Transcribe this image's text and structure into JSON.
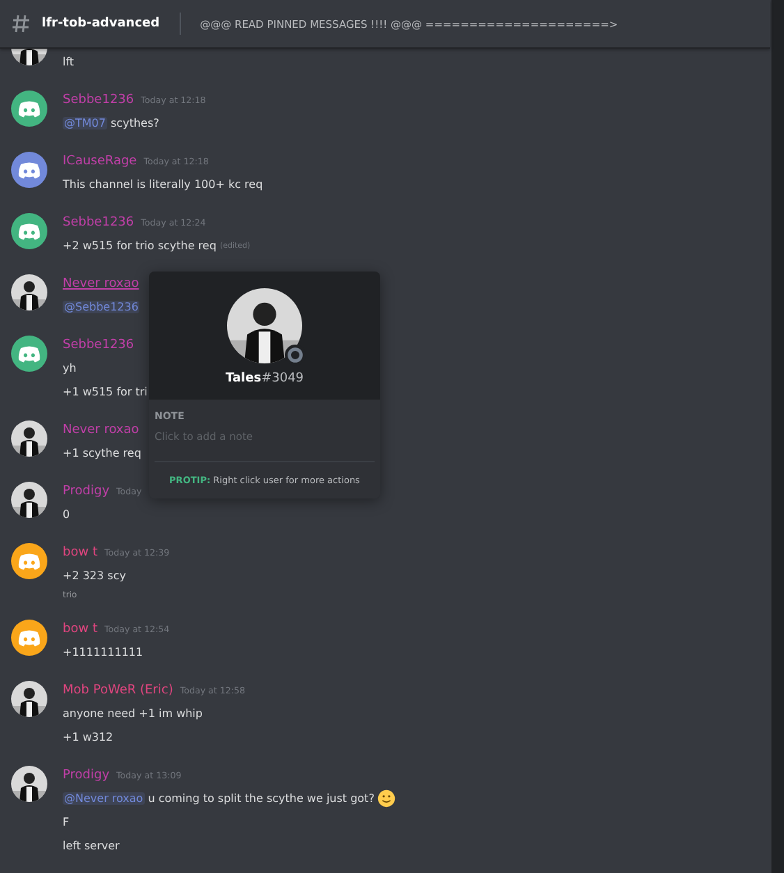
{
  "header": {
    "channel": "lfr-tob-advanced",
    "topic": "@@@ READ PINNED MESSAGES !!!! @@@ =====================>"
  },
  "messages": [
    {
      "avatar": {
        "kind": "picture"
      },
      "lines": [
        [
          {
            "kind": "text",
            "text": "lft"
          }
        ]
      ]
    },
    {
      "author": "Sebbe1236",
      "color": "#c13fa8",
      "hovered": false,
      "time": "Today at 12:18",
      "avatar": {
        "kind": "discord",
        "color": "#43b581"
      },
      "lines": [
        [
          {
            "kind": "mention",
            "text": "@TM07"
          },
          {
            "kind": "text",
            "text": " scythes?"
          }
        ]
      ]
    },
    {
      "author": "ICauseRage",
      "color": "#c13fa8",
      "hovered": false,
      "time": "Today at 12:18",
      "avatar": {
        "kind": "discord",
        "color": "#7289da"
      },
      "lines": [
        [
          {
            "kind": "text",
            "text": "This channel is literally 100+ kc req"
          }
        ]
      ]
    },
    {
      "author": "Sebbe1236",
      "color": "#c13fa8",
      "hovered": false,
      "time": "Today at 12:24",
      "avatar": {
        "kind": "discord",
        "color": "#43b581"
      },
      "lines": [
        [
          {
            "kind": "text",
            "text": "+2 w515 for trio scythe req "
          },
          {
            "kind": "edited",
            "text": "(edited)"
          }
        ]
      ]
    },
    {
      "author": "Never roxao",
      "color": "#c13fa8",
      "hovered": true,
      "avatar": {
        "kind": "picture"
      },
      "lines": [
        [
          {
            "kind": "mention",
            "text": "@Sebbe1236"
          }
        ]
      ]
    },
    {
      "author": "Sebbe1236",
      "color": "#c13fa8",
      "hovered": false,
      "avatar": {
        "kind": "discord",
        "color": "#43b581"
      },
      "lines": [
        [
          {
            "kind": "text",
            "text": "yh"
          }
        ],
        [
          {
            "kind": "text",
            "text": "+1 w515 for tri"
          }
        ]
      ]
    },
    {
      "author": "Never roxao",
      "color": "#c13fa8",
      "hovered": false,
      "avatar": {
        "kind": "picture"
      },
      "lines": [
        [
          {
            "kind": "text",
            "text": "+1 scythe req"
          }
        ]
      ]
    },
    {
      "author": "Prodigy",
      "color": "#c13fa8",
      "hovered": false,
      "time": "Today",
      "avatar": {
        "kind": "picture"
      },
      "lines": [
        [
          {
            "kind": "text",
            "text": "0"
          }
        ]
      ]
    },
    {
      "author": "bow t",
      "color": "#e0457f",
      "hovered": false,
      "time": "Today at 12:39",
      "avatar": {
        "kind": "discord",
        "color": "#faa61a"
      },
      "lines": [
        [
          {
            "kind": "text",
            "text": "+2 323 scy"
          }
        ],
        [
          {
            "kind": "faded",
            "text": "trio"
          }
        ]
      ]
    },
    {
      "author": "bow t",
      "color": "#e0457f",
      "hovered": false,
      "time": "Today at 12:54",
      "avatar": {
        "kind": "discord",
        "color": "#faa61a"
      },
      "lines": [
        [
          {
            "kind": "text",
            "text": "+1111111111"
          }
        ]
      ]
    },
    {
      "author": "Mob PoWeR (Eric)",
      "color": "#e0457f",
      "hovered": false,
      "time": "Today at 12:58",
      "avatar": {
        "kind": "picture"
      },
      "lines": [
        [
          {
            "kind": "text",
            "text": "anyone need +1 im whip"
          }
        ],
        [
          {
            "kind": "text",
            "text": "+1 w312"
          }
        ]
      ]
    },
    {
      "author": "Prodigy",
      "color": "#c13fa8",
      "hovered": false,
      "time": "Today at 13:09",
      "avatar": {
        "kind": "picture"
      },
      "lines": [
        [
          {
            "kind": "mention",
            "text": "@Never roxao"
          },
          {
            "kind": "text",
            "text": " u coming to split the scythe we just got?"
          },
          {
            "kind": "emoji"
          }
        ],
        [
          {
            "kind": "text",
            "text": "F"
          }
        ],
        [
          {
            "kind": "text",
            "text": "left server"
          }
        ]
      ]
    }
  ],
  "popup": {
    "username": "Tales",
    "discriminator": "#3049",
    "note_label": "NOTE",
    "note_placeholder": "Click to add a note",
    "protip_label": "PROTIP:",
    "protip_text": " Right click user for more actions"
  }
}
